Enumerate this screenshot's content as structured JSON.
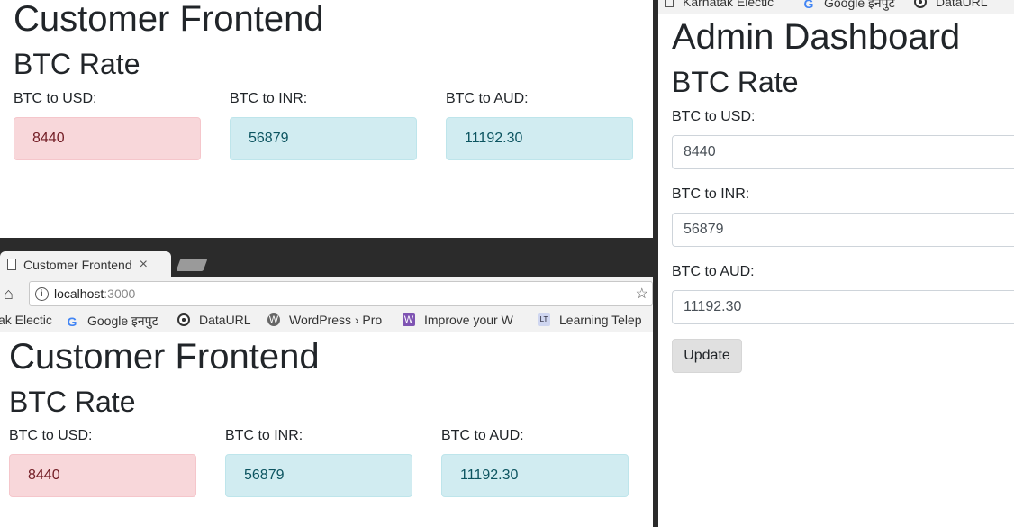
{
  "customer_page": {
    "title": "Customer Frontend",
    "subtitle": "BTC Rate",
    "rates": [
      {
        "label": "BTC to USD:",
        "value": "8440"
      },
      {
        "label": "BTC to INR:",
        "value": "56879"
      },
      {
        "label": "BTC to AUD:",
        "value": "11192.30"
      }
    ]
  },
  "browser": {
    "tab_title": "Customer Frontend",
    "tab_close": "×",
    "url_host": "localhost",
    "url_port": ":3000",
    "bookmarks": [
      {
        "label": "ak Electic",
        "icon": "none"
      },
      {
        "label": "Google इनपुट",
        "icon": "google-icon"
      },
      {
        "label": "DataURL",
        "icon": "target-icon"
      },
      {
        "label": "WordPress › Pro",
        "icon": "wordpress-icon"
      },
      {
        "label": "Improve your W",
        "icon": "woo-icon"
      },
      {
        "label": "Learning Telep",
        "icon": "learning-icon"
      }
    ]
  },
  "admin_bookmarks": [
    {
      "label": "Karnatak Electic",
      "icon": "page-icon"
    },
    {
      "label": "Google इनपुट",
      "icon": "google-icon"
    },
    {
      "label": "DataURL",
      "icon": "target-icon"
    }
  ],
  "admin_page": {
    "title": "Admin Dashboard",
    "subtitle": "BTC Rate",
    "fields": [
      {
        "label": "BTC to USD:",
        "value": "8440"
      },
      {
        "label": "BTC to INR:",
        "value": "56879"
      },
      {
        "label": "BTC to AUD:",
        "value": "11192.30"
      }
    ],
    "update_label": "Update"
  },
  "colors": {
    "danger_bg": "#f8d7da",
    "info_bg": "#d1ecf1",
    "chrome_dark": "#2b2b2b"
  }
}
